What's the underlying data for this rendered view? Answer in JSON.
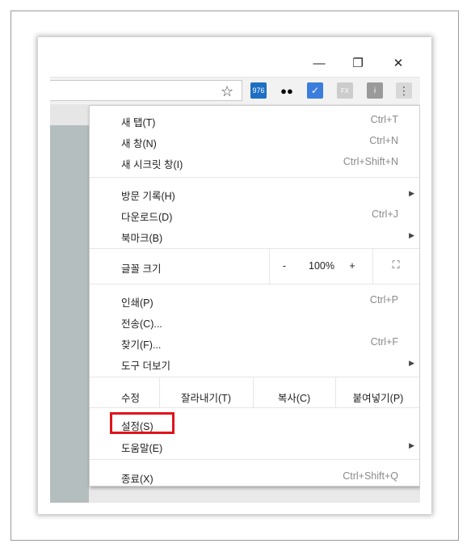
{
  "window": {
    "minimize": "—",
    "maximize": "❐",
    "close": "✕"
  },
  "toolbar": {
    "bookmark_icon": "star-icon",
    "extensions": [
      {
        "name": "speed-dial-extension",
        "badge": "976",
        "color": "#1e6fc4"
      },
      {
        "name": "incognito-extension",
        "color": "#ffffff"
      },
      {
        "name": "check-extension",
        "color": "#3b7ddd"
      },
      {
        "name": "fx-extension",
        "color": "#cccccc"
      },
      {
        "name": "info-extension",
        "color": "#9a9a9a"
      }
    ],
    "menu_icon": "more-vert-icon"
  },
  "menu": {
    "items_group1": [
      {
        "label": "새 탭(T)",
        "shortcut": "Ctrl+T"
      },
      {
        "label": "새 창(N)",
        "shortcut": "Ctrl+N"
      },
      {
        "label": "새 시크릿 창(I)",
        "shortcut": "Ctrl+Shift+N"
      }
    ],
    "items_group2": [
      {
        "label": "방문 기록(H)",
        "shortcut": ""
      },
      {
        "label": "다운로드(D)",
        "shortcut": "Ctrl+J"
      },
      {
        "label": "북마크(B)",
        "shortcut": ""
      }
    ],
    "zoom": {
      "label": "글꼴 크기",
      "minus": "-",
      "value": "100%",
      "plus": "+"
    },
    "items_group3": [
      {
        "label": "인쇄(P)",
        "shortcut": "Ctrl+P"
      },
      {
        "label": "전송(C)...",
        "shortcut": ""
      },
      {
        "label": "찾기(F)...",
        "shortcut": "Ctrl+F"
      },
      {
        "label": "도구 더보기",
        "shortcut": ""
      }
    ],
    "edit": {
      "label": "수정",
      "cut": "잘라내기(T)",
      "copy": "복사(C)",
      "paste": "붙여넣기(P)"
    },
    "settings": "설정(S)",
    "help": "도움말(E)",
    "exit": {
      "label": "종료(X)",
      "shortcut": "Ctrl+Shift+Q"
    }
  },
  "accent": {
    "highlight": "#e0141b"
  }
}
